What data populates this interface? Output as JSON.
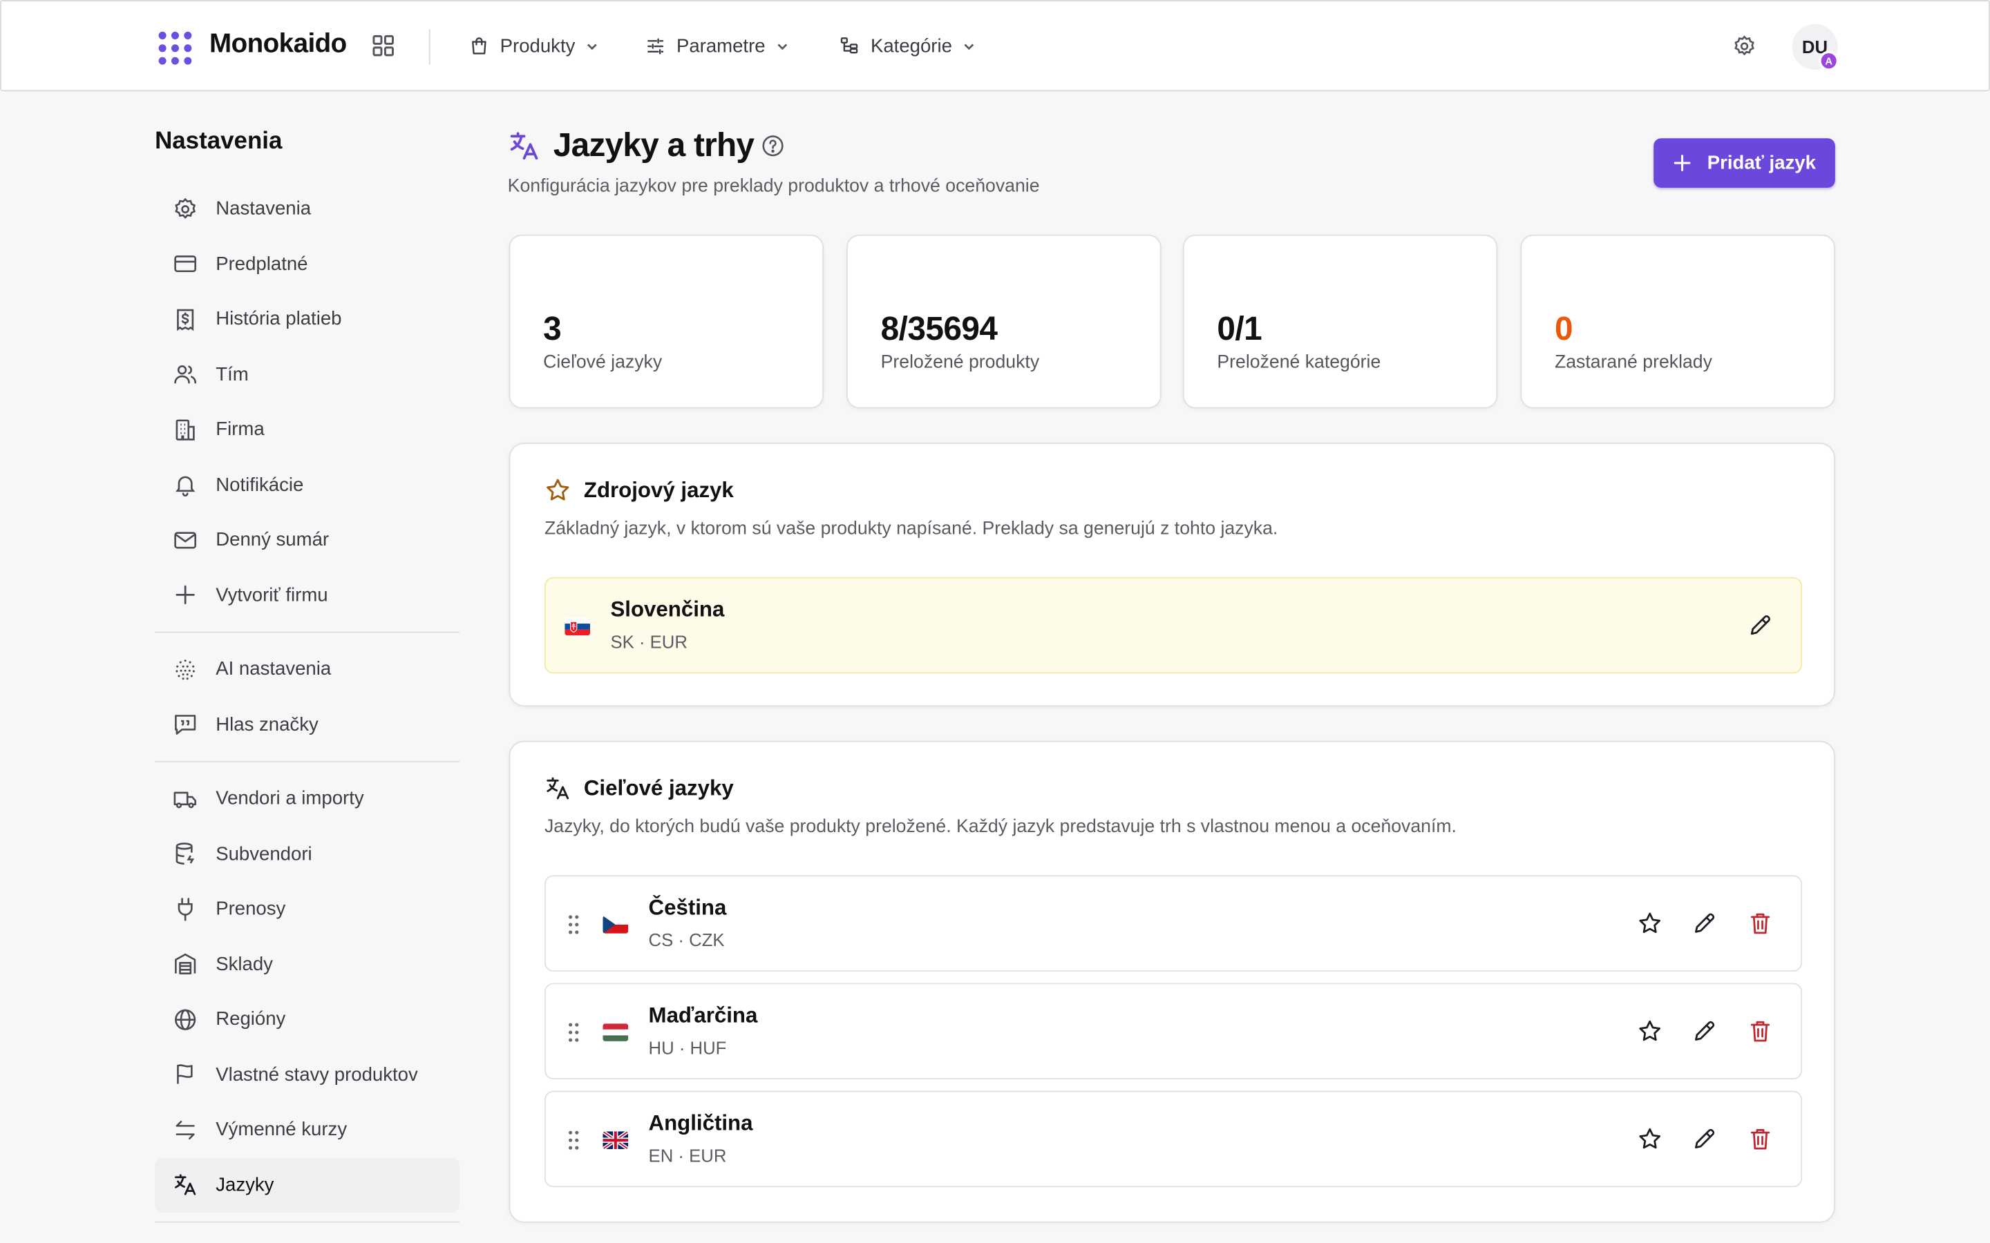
{
  "navbar": {
    "brand": "Monokaido",
    "menus": [
      {
        "label": "Produkty",
        "icon": "shopping-bag-icon"
      },
      {
        "label": "Parametre",
        "icon": "sliders-icon"
      },
      {
        "label": "Kategórie",
        "icon": "category-tree-icon"
      }
    ],
    "avatar_initials": "DU",
    "avatar_badge": "A"
  },
  "sidebar": {
    "title": "Nastavenia",
    "groups": [
      [
        {
          "label": "Nastavenia",
          "icon": "gear-icon"
        },
        {
          "label": "Predplatné",
          "icon": "credit-card-icon"
        },
        {
          "label": "História platieb",
          "icon": "receipt-dollar-icon"
        },
        {
          "label": "Tím",
          "icon": "users-icon"
        },
        {
          "label": "Firma",
          "icon": "building-icon"
        },
        {
          "label": "Notifikácie",
          "icon": "bell-icon"
        },
        {
          "label": "Denný sumár",
          "icon": "mail-icon"
        },
        {
          "label": "Vytvoriť firmu",
          "icon": "plus-icon"
        }
      ],
      [
        {
          "label": "AI nastavenia",
          "icon": "ai-dots-icon"
        },
        {
          "label": "Hlas značky",
          "icon": "quote-bubble-icon"
        }
      ],
      [
        {
          "label": "Vendori a importy",
          "icon": "truck-icon"
        },
        {
          "label": "Subvendori",
          "icon": "database-icon"
        },
        {
          "label": "Prenosy",
          "icon": "plug-icon"
        },
        {
          "label": "Sklady",
          "icon": "warehouse-icon"
        },
        {
          "label": "Regióny",
          "icon": "globe-icon"
        },
        {
          "label": "Vlastné stavy produktov",
          "icon": "flag-icon"
        },
        {
          "label": "Výmenné kurzy",
          "icon": "arrows-exchange-icon"
        },
        {
          "label": "Jazyky",
          "icon": "translate-icon",
          "active": true
        }
      ]
    ]
  },
  "header": {
    "title": "Jazyky a trhy",
    "subtitle": "Konfigurácia jazykov pre preklady produktov a trhové oceňovanie",
    "add_button": "Pridať jazyk"
  },
  "stats": [
    {
      "value": "3",
      "label": "Cieľové jazyky",
      "color": "#111114"
    },
    {
      "value": "8/35694",
      "label": "Preložené produkty",
      "color": "#111114"
    },
    {
      "value": "0/1",
      "label": "Preložené kategórie",
      "color": "#111114"
    },
    {
      "value": "0",
      "label": "Zastarané preklady",
      "color": "#e8590c"
    }
  ],
  "source": {
    "title": "Zdrojový jazyk",
    "description": "Základný jazyk, v ktorom sú vaše produkty napísané. Preklady sa generujú z tohto jazyka.",
    "language": {
      "name": "Slovenčina",
      "code": "SK · EUR",
      "flag": "sk-flag-icon"
    }
  },
  "targets": {
    "title": "Cieľové jazyky",
    "description": "Jazyky, do ktorých budú vaše produkty preložené. Každý jazyk predstavuje trh s vlastnou menou a oceňovaním.",
    "languages": [
      {
        "name": "Čeština",
        "code": "CS · CZK",
        "flag": "cz-flag-icon"
      },
      {
        "name": "Maďarčina",
        "code": "HU · HUF",
        "flag": "hu-flag-icon"
      },
      {
        "name": "Angličtina",
        "code": "EN · EUR",
        "flag": "gb-flag-icon"
      }
    ]
  },
  "colors": {
    "accent": "#6b47dc",
    "danger": "#c0262d",
    "warning": "#e8590c",
    "star": "#a15c0d"
  }
}
